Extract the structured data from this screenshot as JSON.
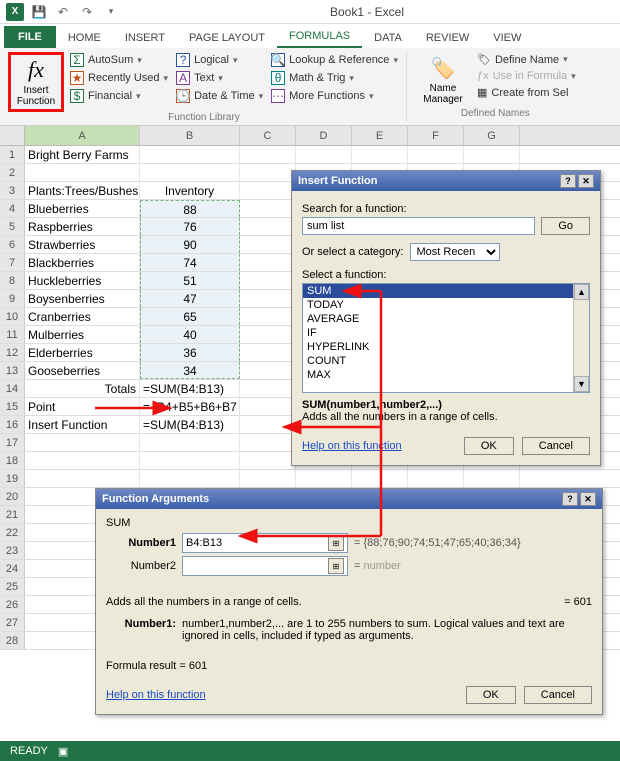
{
  "title": "Book1 - Excel",
  "tabs": {
    "file": "FILE",
    "home": "HOME",
    "insert": "INSERT",
    "pagelayout": "PAGE LAYOUT",
    "formulas": "FORMULAS",
    "data": "DATA",
    "review": "REVIEW",
    "view": "VIEW"
  },
  "ribbon": {
    "insert_fn": "Insert Function",
    "col1": {
      "autosum": "AutoSum",
      "recent": "Recently Used",
      "financial": "Financial"
    },
    "col2": {
      "logical": "Logical",
      "text": "Text",
      "datetime": "Date & Time"
    },
    "col3": {
      "lookup": "Lookup & Reference",
      "math": "Math & Trig",
      "more": "More Functions"
    },
    "name_mgr": "Name Manager",
    "dn": {
      "define": "Define Name",
      "usein": "Use in Formula",
      "create": "Create from Sel"
    },
    "grp_lib": "Function Library",
    "grp_dn": "Defined Names"
  },
  "columns": [
    "A",
    "B",
    "C",
    "D",
    "E",
    "F",
    "G"
  ],
  "rows": [
    {
      "n": 1,
      "a": "Bright Berry Farms",
      "b": ""
    },
    {
      "n": 2,
      "a": "",
      "b": ""
    },
    {
      "n": 3,
      "a": "Plants:Trees/Bushes",
      "b": "Inventory"
    },
    {
      "n": 4,
      "a": "Blueberries",
      "b": "88"
    },
    {
      "n": 5,
      "a": "Raspberries",
      "b": "76"
    },
    {
      "n": 6,
      "a": "Strawberries",
      "b": "90"
    },
    {
      "n": 7,
      "a": "Blackberries",
      "b": "74"
    },
    {
      "n": 8,
      "a": "Huckleberries",
      "b": "51"
    },
    {
      "n": 9,
      "a": "Boysenberries",
      "b": "47"
    },
    {
      "n": 10,
      "a": "Cranberries",
      "b": "65"
    },
    {
      "n": 11,
      "a": "Mulberries",
      "b": "40"
    },
    {
      "n": 12,
      "a": "Elderberries",
      "b": "36"
    },
    {
      "n": 13,
      "a": "Gooseberries",
      "b": "34"
    },
    {
      "n": 14,
      "a": "Totals",
      "b": "=SUM(B4:B13)"
    },
    {
      "n": 15,
      "a": "Point",
      "b": "=+B4+B5+B6+B7"
    },
    {
      "n": 16,
      "a": "Insert Function",
      "b": "=SUM(B4:B13)"
    },
    {
      "n": 17,
      "a": "",
      "b": ""
    },
    {
      "n": 18,
      "a": "",
      "b": ""
    },
    {
      "n": 19,
      "a": "",
      "b": ""
    },
    {
      "n": 20,
      "a": "",
      "b": ""
    },
    {
      "n": 21,
      "a": "",
      "b": ""
    },
    {
      "n": 22,
      "a": "",
      "b": ""
    },
    {
      "n": 23,
      "a": "",
      "b": ""
    },
    {
      "n": 24,
      "a": "",
      "b": ""
    },
    {
      "n": 25,
      "a": "",
      "b": ""
    },
    {
      "n": 26,
      "a": "",
      "b": ""
    },
    {
      "n": 27,
      "a": "",
      "b": ""
    },
    {
      "n": 28,
      "a": "",
      "b": ""
    }
  ],
  "insert_dlg": {
    "title": "Insert Function",
    "search_lbl": "Search for a function:",
    "search_val": "sum list",
    "go": "Go",
    "cat_lbl": "Or select a category:",
    "cat_val": "Most Recen",
    "select_lbl": "Select a function:",
    "items": [
      "SUM",
      "TODAY",
      "AVERAGE",
      "IF",
      "HYPERLINK",
      "COUNT",
      "MAX"
    ],
    "sig": "SUM(number1,number2,...)",
    "desc": "Adds all the numbers in a range of cells.",
    "help": "Help on this function",
    "ok": "OK",
    "cancel": "Cancel"
  },
  "fa_dlg": {
    "title": "Function Arguments",
    "fn": "SUM",
    "n1_lbl": "Number1",
    "n1_val": "B4:B13",
    "n1_arr": "{88;76;90;74;51;47;65;40;36;34}",
    "n2_lbl": "Number2",
    "n2_val": "",
    "n2_hint": "number",
    "desc": "Adds all the numbers in a range of cells.",
    "eq": "=  601",
    "argdesc_lbl": "Number1:",
    "argdesc": "number1,number2,... are 1 to 255 numbers to sum. Logical values and text are ignored in cells, included if typed as arguments.",
    "result": "Formula result =  601",
    "help": "Help on this function",
    "ok": "OK",
    "cancel": "Cancel"
  },
  "status": "READY"
}
